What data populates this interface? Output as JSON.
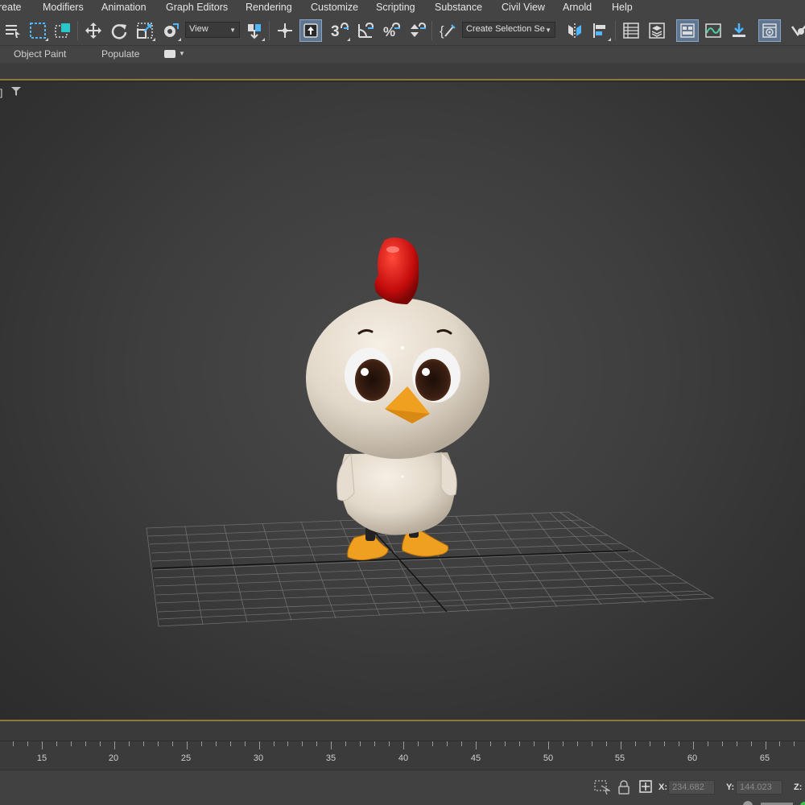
{
  "menu": {
    "items": [
      "reate",
      "Modifiers",
      "Animation",
      "Graph Editors",
      "Rendering",
      "Customize",
      "Scripting",
      "Substance",
      "Civil View",
      "Arnold",
      "Help"
    ]
  },
  "toolbar": {
    "view_dropdown": "View",
    "selection_set_dropdown": "Create Selection Se",
    "icons": [
      "select-by-name-icon",
      "rectangular-selection-icon",
      "window-crossing-icon",
      "select-and-move-icon",
      "select-and-rotate-icon",
      "select-and-scale-icon",
      "select-and-place-icon",
      "reference-coordinate-icon",
      "use-pivot-icon",
      "select-and-manipulate-icon",
      "keyboard-shortcut-icon",
      "snaps-toggle-icon",
      "angle-snap-icon",
      "percent-snap-icon",
      "spinner-snap-icon",
      "edit-named-selection-icon",
      "mirror-icon",
      "align-icon",
      "scene-explorer-icon",
      "layer-explorer-icon",
      "toggle-ribbon-icon",
      "curve-editor-icon",
      "schematic-view-icon",
      "material-editor-icon",
      "render-setup-icon"
    ]
  },
  "ribbon": {
    "tabs": [
      "Object Paint",
      "Populate"
    ]
  },
  "viewport": {
    "label": "]",
    "filter_icon": "filter-icon"
  },
  "timeline": {
    "ticks": [
      "15",
      "20",
      "25",
      "30",
      "35",
      "40",
      "45",
      "50",
      "55",
      "60",
      "65"
    ]
  },
  "status": {
    "x_label": "X:",
    "x_value": "234.682",
    "y_label": "Y:",
    "y_value": "144.023",
    "z_label": "Z:"
  },
  "colors": {
    "accent_blue": "#4fb6ff",
    "viewport_border": "#8c7a3c",
    "comb_red": "#d01010",
    "beak_orange": "#f0a020"
  }
}
